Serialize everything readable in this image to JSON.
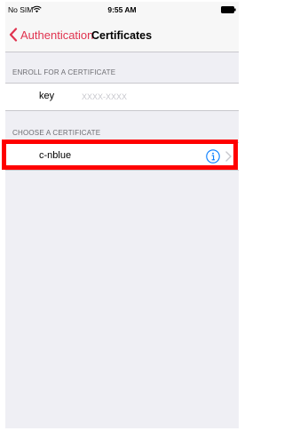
{
  "status_bar": {
    "carrier": "No SIM",
    "time": "9:55 AM",
    "wifi_icon": "wifi-icon",
    "battery_icon": "battery-icon"
  },
  "nav": {
    "back_label": "Authentication",
    "back_icon": "chevron-left-icon",
    "title": "Certificates",
    "accent_color": "#e0334f"
  },
  "enroll_section": {
    "header": "ENROLL FOR A CERTIFICATE",
    "key_label": "key",
    "key_value": "",
    "key_placeholder": "XXXX-XXXX"
  },
  "choose_section": {
    "header": "CHOOSE A CERTIFICATE",
    "certificates": [
      {
        "name": "c-nblue",
        "info_icon": "info-icon",
        "disclosure_icon": "chevron-right-icon",
        "highlighted": true
      }
    ]
  },
  "colors": {
    "background": "#efeff4",
    "info_blue": "#007aff",
    "highlight_red": "#ff0000"
  }
}
